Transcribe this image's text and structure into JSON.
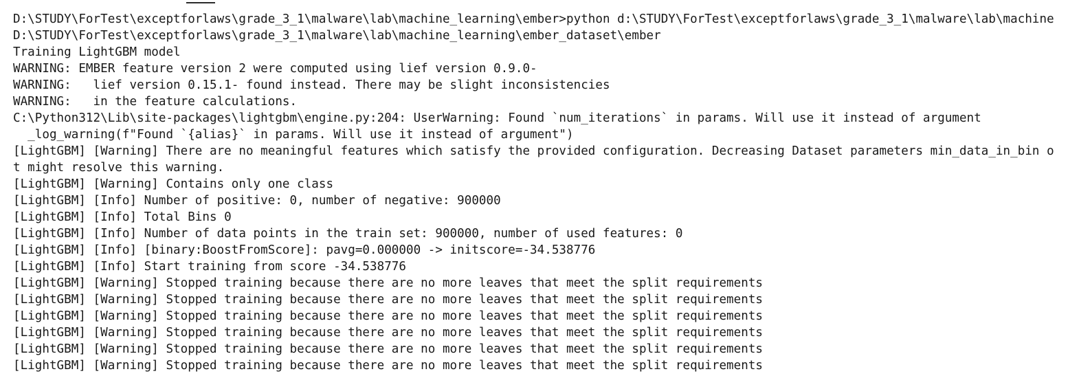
{
  "terminal": {
    "lines": [
      "D:\\STUDY\\ForTest\\exceptforlaws\\grade_3_1\\malware\\lab\\machine_learning\\ember>python d:\\STUDY\\ForTest\\exceptforlaws\\grade_3_1\\malware\\lab\\machine",
      "D:\\STUDY\\ForTest\\exceptforlaws\\grade_3_1\\malware\\lab\\machine_learning\\ember_dataset\\ember",
      "Training LightGBM model",
      "WARNING: EMBER feature version 2 were computed using lief version 0.9.0-",
      "WARNING:   lief version 0.15.1- found instead. There may be slight inconsistencies",
      "WARNING:   in the feature calculations.",
      "C:\\Python312\\Lib\\site-packages\\lightgbm\\engine.py:204: UserWarning: Found `num_iterations` in params. Will use it instead of argument",
      "  _log_warning(f\"Found `{alias}` in params. Will use it instead of argument\")",
      "[LightGBM] [Warning] There are no meaningful features which satisfy the provided configuration. Decreasing Dataset parameters min_data_in_bin o",
      "t might resolve this warning.",
      "[LightGBM] [Warning] Contains only one class",
      "[LightGBM] [Info] Number of positive: 0, number of negative: 900000",
      "[LightGBM] [Info] Total Bins 0",
      "[LightGBM] [Info] Number of data points in the train set: 900000, number of used features: 0",
      "[LightGBM] [Info] [binary:BoostFromScore]: pavg=0.000000 -> initscore=-34.538776",
      "[LightGBM] [Info] Start training from score -34.538776",
      "[LightGBM] [Warning] Stopped training because there are no more leaves that meet the split requirements",
      "[LightGBM] [Warning] Stopped training because there are no more leaves that meet the split requirements",
      "[LightGBM] [Warning] Stopped training because there are no more leaves that meet the split requirements",
      "[LightGBM] [Warning] Stopped training because there are no more leaves that meet the split requirements",
      "[LightGBM] [Warning] Stopped training because there are no more leaves that meet the split requirements",
      "[LightGBM] [Warning] Stopped training because there are no more leaves that meet the split requirements"
    ]
  },
  "colors": {
    "background": "#ffffff",
    "text": "#1a1a1a"
  }
}
